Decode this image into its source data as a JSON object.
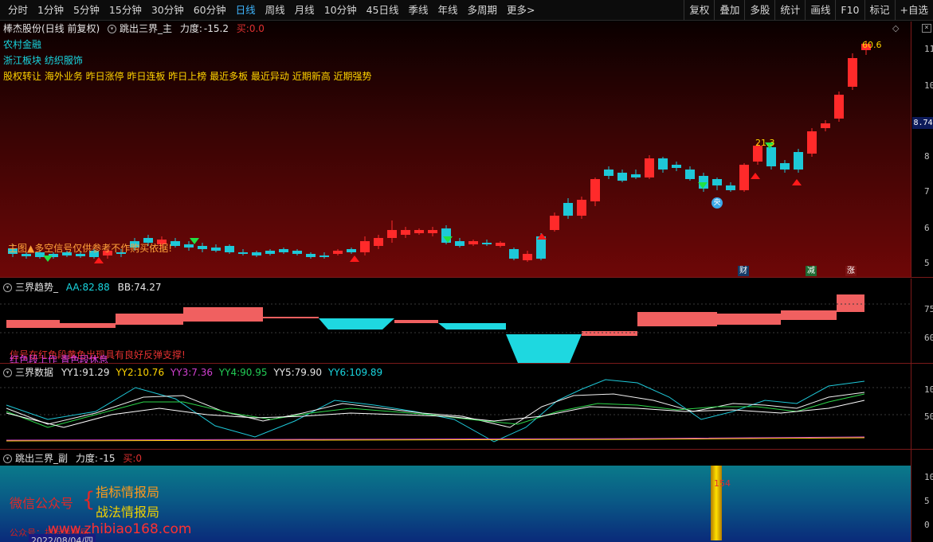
{
  "toolbar": {
    "left_items": [
      "分时",
      "1分钟",
      "5分钟",
      "15分钟",
      "30分钟",
      "60分钟",
      "日线",
      "周线",
      "月线",
      "10分钟",
      "45日线",
      "季线",
      "年线",
      "多周期",
      "更多>"
    ],
    "active_index": 6,
    "right_items": [
      "复权",
      "叠加",
      "多股",
      "统计",
      "画线",
      "F10",
      "标记",
      "+自选"
    ]
  },
  "main": {
    "stock_name": "棒杰股份(日线 前复权)",
    "indicator_name": "跳出三界_主",
    "power_label": "力度:",
    "power_value": "-15.2",
    "buy_label": "买:",
    "buy_value": "0.0",
    "tag1": "农村金融",
    "tag2": "浙江板块  纺织服饰",
    "tags3": "股权转让 海外业务 昨日涨停 昨日连板 昨日上榜 最近多板 最近异动 近期新高 近期强势",
    "note": "主图▲多空信号仅供参考不作购买依据!",
    "high_label": "60.6",
    "peak_label": "21.3",
    "right_ticks": [
      "11",
      "10",
      "8.74",
      "8",
      "7",
      "6",
      "5"
    ],
    "price_box": "8.74",
    "bottom_marks": [
      "财",
      "减",
      "涨"
    ],
    "badge": "央"
  },
  "p2": {
    "name": "三界趋势_",
    "aa_label": "AA:",
    "aa_value": "82.88",
    "bb_label": "BB:",
    "bb_value": "74.27",
    "note1": "信号在红色段黄色出现具有良好反弹支撑!",
    "note2": "红色段上作 青色段休息",
    "right_ticks": [
      "75",
      "60"
    ]
  },
  "p3": {
    "name": "三界数据",
    "yy1_label": "YY1:",
    "yy1": "91.29",
    "yy2_label": "YY2:",
    "yy2": "10.76",
    "yy3_label": "YY3:",
    "yy3": "7.36",
    "yy4_label": "YY4:",
    "yy4": "90.95",
    "yy5_label": "YY5:",
    "yy5": "79.90",
    "yy6_label": "YY6:",
    "yy6": "109.89",
    "right_ticks": [
      "10",
      "50"
    ]
  },
  "p4": {
    "name": "跳出三界_副",
    "power_label": "力度:",
    "power_value": "-15",
    "buy_label": "买:",
    "buy_value": "0",
    "wechat": "微信公众号",
    "brand1": "指标情报局",
    "brand2": "战法情报局",
    "site": "www.zhibiao168.com",
    "under": "公众号：指标情报局",
    "bar_label": "154",
    "date": "2022/08/04/四",
    "right_ticks": [
      "10",
      "5",
      "0"
    ]
  },
  "colors": {
    "up": "#ff2a2a",
    "down": "#1ec8d8",
    "accent": "#3fb6ff"
  }
}
